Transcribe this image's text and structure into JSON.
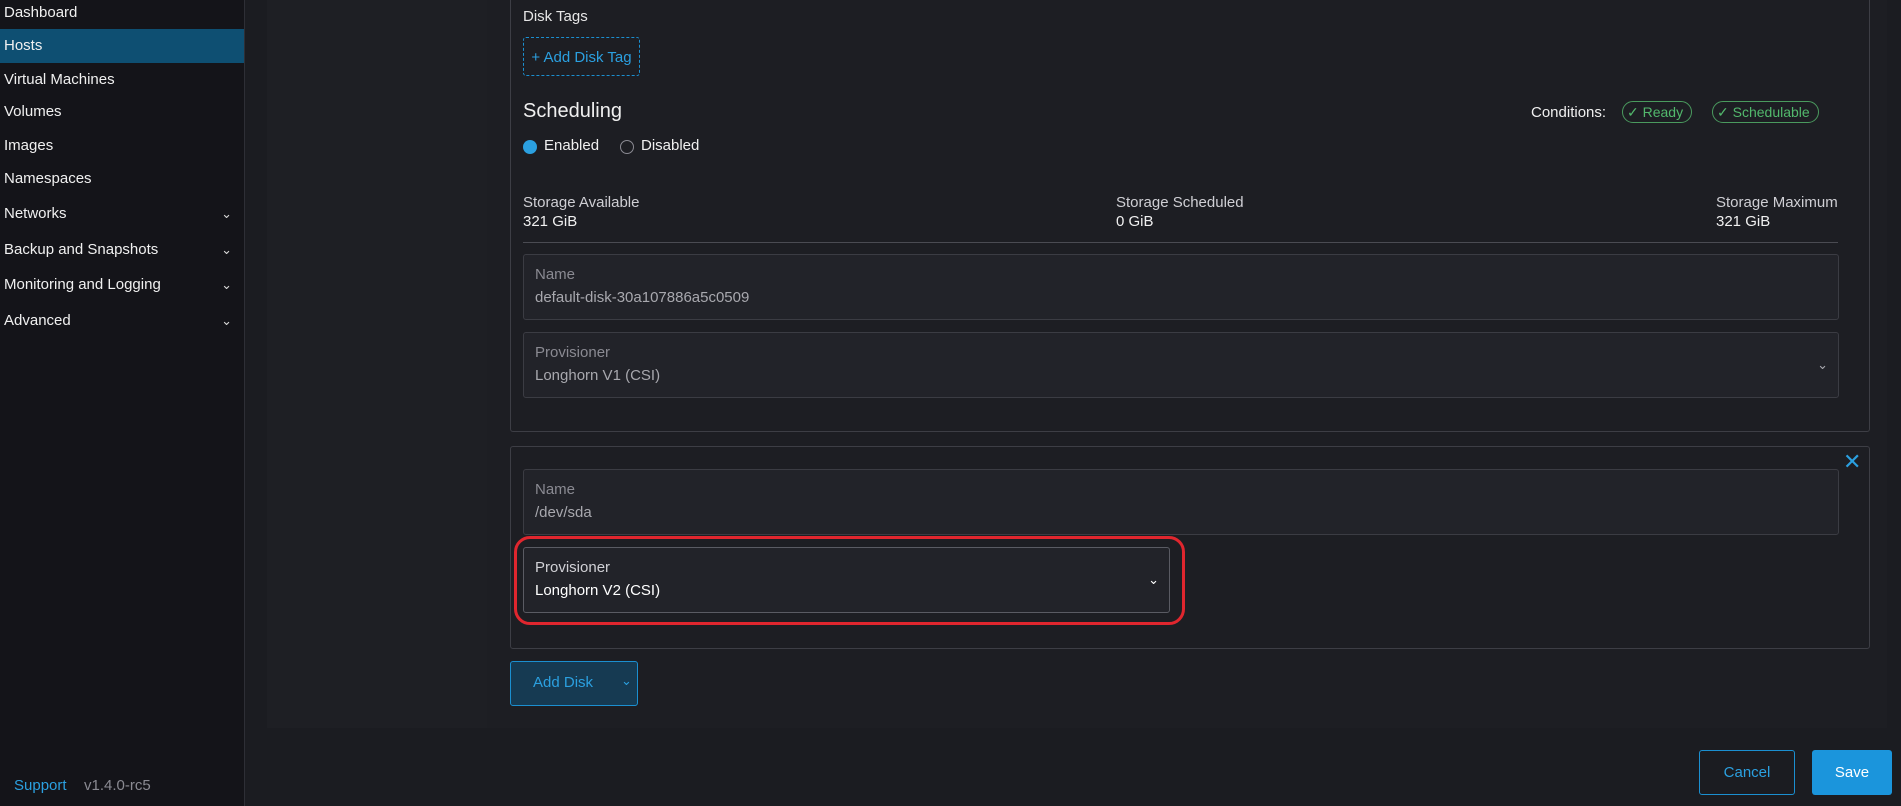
{
  "sidebar": {
    "items": [
      {
        "label": "Dashboard",
        "expandable": false,
        "active": false
      },
      {
        "label": "Hosts",
        "expandable": false,
        "active": true
      },
      {
        "label": "Virtual Machines",
        "expandable": false,
        "active": false
      },
      {
        "label": "Volumes",
        "expandable": false,
        "active": false
      },
      {
        "label": "Images",
        "expandable": false,
        "active": false
      },
      {
        "label": "Namespaces",
        "expandable": false,
        "active": false
      },
      {
        "label": "Networks",
        "expandable": true,
        "active": false
      },
      {
        "label": "Backup and Snapshots",
        "expandable": true,
        "active": false
      },
      {
        "label": "Monitoring and Logging",
        "expandable": true,
        "active": false
      },
      {
        "label": "Advanced",
        "expandable": true,
        "active": false
      }
    ],
    "support_label": "Support",
    "version": "v1.4.0-rc5"
  },
  "disk1": {
    "disk_tags_label": "Disk Tags",
    "add_tag_label": "+ Add Disk Tag",
    "scheduling_title": "Scheduling",
    "scheduling_options": [
      "Enabled",
      "Disabled"
    ],
    "scheduling_selected": "Enabled",
    "conditions_label": "Conditions:",
    "conditions": [
      "Ready",
      "Schedulable"
    ],
    "storage_available_label": "Storage Available",
    "storage_available_value": "321 GiB",
    "storage_scheduled_label": "Storage Scheduled",
    "storage_scheduled_value": "0 GiB",
    "storage_maximum_label": "Storage Maximum",
    "storage_maximum_value": "321 GiB",
    "name_label": "Name",
    "name_value": "default-disk-30a107886a5c0509",
    "provisioner_label": "Provisioner",
    "provisioner_value": "Longhorn V1 (CSI)"
  },
  "disk2": {
    "name_label": "Name",
    "name_value": "/dev/sda",
    "provisioner_label": "Provisioner",
    "provisioner_value": "Longhorn V2 (CSI)"
  },
  "actions": {
    "add_disk_label": "Add Disk",
    "cancel_label": "Cancel",
    "save_label": "Save"
  },
  "colors": {
    "accent": "#2ba0e0",
    "active_nav": "#0e4f72",
    "success": "#52b86c",
    "highlight": "#e0262e"
  }
}
